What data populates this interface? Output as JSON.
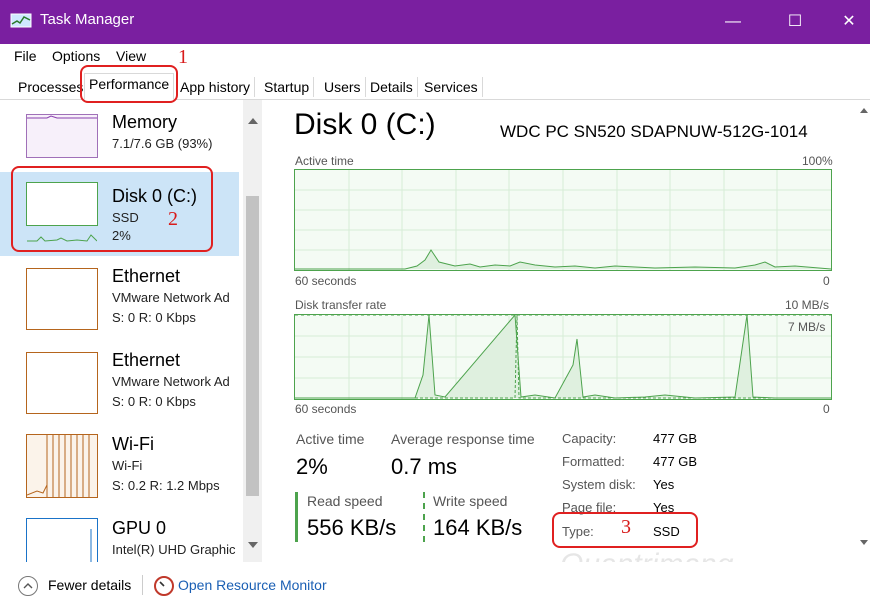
{
  "window": {
    "title": "Task Manager",
    "controls": {
      "minimize": "—",
      "maximize": "☐",
      "close": "✕"
    }
  },
  "menu": {
    "file": "File",
    "options": "Options",
    "view": "View"
  },
  "tabs": [
    "Processes",
    "Performance",
    "App history",
    "Startup",
    "Users",
    "Details",
    "Services"
  ],
  "sidebar": {
    "items": [
      {
        "title": "Memory",
        "line1": "7.1/7.6 GB (93%)",
        "line2": ""
      },
      {
        "title": "Disk 0 (C:)",
        "line1": "SSD",
        "line2": "2%"
      },
      {
        "title": "Ethernet",
        "line1": "VMware Network Ad",
        "line2": "S: 0 R: 0 Kbps"
      },
      {
        "title": "Ethernet",
        "line1": "VMware Network Ad",
        "line2": "S: 0 R: 0 Kbps"
      },
      {
        "title": "Wi-Fi",
        "line1": "Wi-Fi",
        "line2": "S: 0.2 R: 1.2 Mbps"
      },
      {
        "title": "GPU 0",
        "line1": "Intel(R) UHD Graphic",
        "line2": ""
      }
    ]
  },
  "detail": {
    "title": "Disk 0 (C:)",
    "model": "WDC PC SN520 SDAPNUW-512G-1014",
    "graph1": {
      "label": "Active time",
      "max": "100%",
      "time": "60 seconds",
      "min": "0"
    },
    "graph2": {
      "label": "Disk transfer rate",
      "max": "10 MB/s",
      "mark": "7 MB/s",
      "time": "60 seconds",
      "min": "0"
    },
    "stats": {
      "active_time_label": "Active time",
      "active_time": "2%",
      "response_label": "Average response time",
      "response": "0.7 ms",
      "read_label": "Read speed",
      "read": "556 KB/s",
      "write_label": "Write speed",
      "write": "164 KB/s"
    },
    "props": [
      {
        "k": "Capacity:",
        "v": "477 GB"
      },
      {
        "k": "Formatted:",
        "v": "477 GB"
      },
      {
        "k": "System disk:",
        "v": "Yes"
      },
      {
        "k": "Page file:",
        "v": "Yes"
      },
      {
        "k": "Type:",
        "v": "SSD"
      }
    ]
  },
  "footer": {
    "fewer": "Fewer details",
    "monitor": "Open Resource Monitor"
  },
  "annotations": {
    "n1": "1",
    "n2": "2",
    "n3": "3"
  },
  "watermark": "Quantrimang",
  "colors": {
    "titlebar": "#7a1fa0",
    "disk_green": "#4da34d",
    "link": "#1a5fb4",
    "annotation": "#e02020"
  }
}
